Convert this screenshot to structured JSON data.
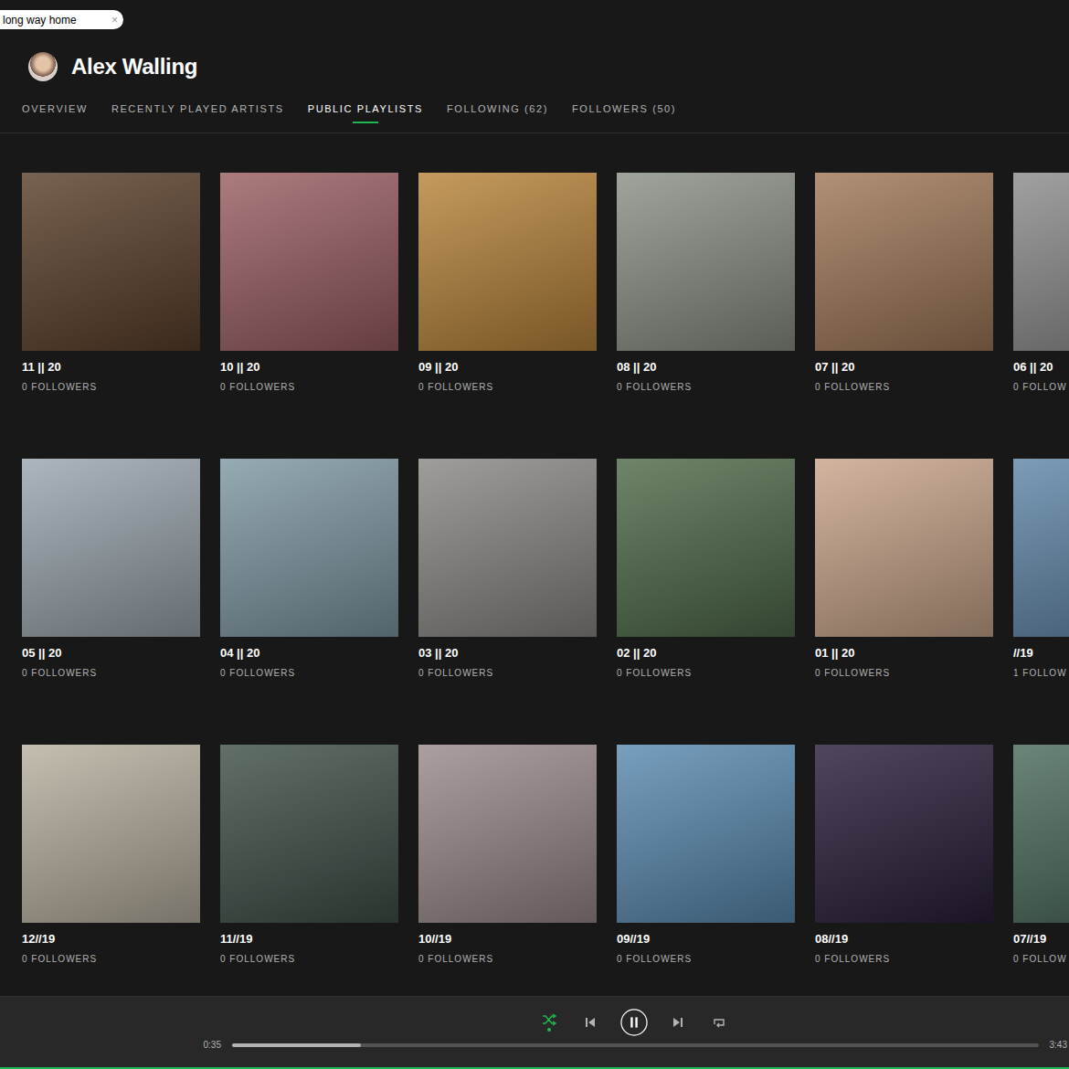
{
  "search": {
    "value": "long way home",
    "clear": "×"
  },
  "profile": {
    "name": "Alex Walling"
  },
  "tabs": [
    {
      "label": "OVERVIEW",
      "selected": false
    },
    {
      "label": "RECENTLY PLAYED ARTISTS",
      "selected": false
    },
    {
      "label": "PUBLIC PLAYLISTS",
      "selected": true
    },
    {
      "label": "FOLLOWING (62)",
      "selected": false
    },
    {
      "label": "FOLLOWERS (50)",
      "selected": false
    }
  ],
  "playlists": [
    {
      "title": "11 || 20",
      "followers": "0 FOLLOWERS",
      "color": "#5a3f2a"
    },
    {
      "title": "10 || 20",
      "followers": "0 FOLLOWERS",
      "color": "#9a5e62"
    },
    {
      "title": "09 || 20",
      "followers": "0 FOLLOWERS",
      "color": "#b8843a"
    },
    {
      "title": "08 || 20",
      "followers": "0 FOLLOWERS",
      "color": "#8a9086"
    },
    {
      "title": "07 || 20",
      "followers": "0 FOLLOWERS",
      "color": "#a07858"
    },
    {
      "title": "06 || 20",
      "followers": "0 FOLLOW",
      "color": "#8c8c8c"
    },
    {
      "title": "05 || 20",
      "followers": "0 FOLLOWERS",
      "color": "#9aa6ae"
    },
    {
      "title": "04 || 20",
      "followers": "0 FOLLOWERS",
      "color": "#7f98a4"
    },
    {
      "title": "03 || 20",
      "followers": "0 FOLLOWERS",
      "color": "#8a8884"
    },
    {
      "title": "02 || 20",
      "followers": "0 FOLLOWERS",
      "color": "#4f6a4a"
    },
    {
      "title": "01 || 20",
      "followers": "0 FOLLOWERS",
      "color": "#c9a58a"
    },
    {
      "title": "//19",
      "followers": "1 FOLLOW",
      "color": "#5f86a8"
    },
    {
      "title": "12//19",
      "followers": "0 FOLLOWERS",
      "color": "#b8b0a0"
    },
    {
      "title": "11//19",
      "followers": "0 FOLLOWERS",
      "color": "#3f5048"
    },
    {
      "title": "10//19",
      "followers": "0 FOLLOWERS",
      "color": "#9a8a8a"
    },
    {
      "title": "09//19",
      "followers": "0 FOLLOWERS",
      "color": "#5a8ab0"
    },
    {
      "title": "08//19",
      "followers": "0 FOLLOWERS",
      "color": "#2a1e3a"
    },
    {
      "title": "07//19",
      "followers": "0 FOLLOW",
      "color": "#4a6a5a"
    }
  ],
  "player": {
    "shuffle": true,
    "playing": true,
    "elapsed": "0:35",
    "duration": "3:43",
    "level": 0.16
  }
}
